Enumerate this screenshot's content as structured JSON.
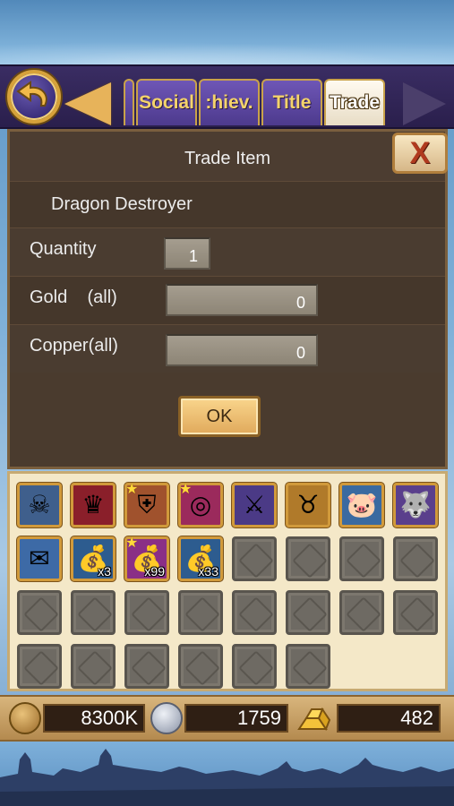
{
  "tabs": [
    {
      "label": "Social",
      "active": false
    },
    {
      "label": ":hiev.",
      "active": false
    },
    {
      "label": "Title",
      "active": false
    },
    {
      "label": "Trade",
      "active": true
    }
  ],
  "dialog": {
    "title": "Trade Item",
    "close_label": "X",
    "item_name": "Dragon Destroyer",
    "quantity_label": "Quantity",
    "quantity_value": "1",
    "gold_label": "Gold    (all)",
    "gold_value": "0",
    "copper_label": "Copper(all)",
    "copper_value": "0",
    "ok_label": "OK"
  },
  "inventory": {
    "items": [
      {
        "icon": "skull-helmet-icon",
        "glyph": "☠",
        "bg": "#3f5f8c",
        "count": "",
        "star": false
      },
      {
        "icon": "crown-icon",
        "glyph": "♛",
        "bg": "#8a1f2a",
        "count": "",
        "star": false
      },
      {
        "icon": "armor-icon",
        "glyph": "⛨",
        "bg": "#a0522d",
        "count": "",
        "star": true
      },
      {
        "icon": "ring-icon",
        "glyph": "◎",
        "bg": "#9b2a5c",
        "count": "",
        "star": true
      },
      {
        "icon": "crossed-axes-icon",
        "glyph": "⚔",
        "bg": "#4b3a86",
        "count": "",
        "star": false
      },
      {
        "icon": "golden-beast-icon",
        "glyph": "♉",
        "bg": "#b07a2a",
        "count": "",
        "star": false
      },
      {
        "icon": "pig-icon",
        "glyph": "🐷",
        "bg": "#3a6aa0",
        "count": "",
        "star": false
      },
      {
        "icon": "wolf-icon",
        "glyph": "🐺",
        "bg": "#5a3f8c",
        "count": "",
        "star": false
      },
      {
        "icon": "scroll-icon",
        "glyph": "✉",
        "bg": "#3d6aa6",
        "count": "",
        "star": false
      },
      {
        "icon": "money-bag-icon",
        "glyph": "💰",
        "bg": "#2d5c8f",
        "count": "x3",
        "star": false
      },
      {
        "icon": "money-bag-icon",
        "glyph": "💰",
        "bg": "#8a2f86",
        "count": "x99",
        "star": true
      },
      {
        "icon": "money-bag-icon",
        "glyph": "💰",
        "bg": "#2d5c8f",
        "count": "x33",
        "star": false
      }
    ],
    "empty_slots": 18
  },
  "currency": {
    "gold": "8300K",
    "silver": "1759",
    "gems": "482"
  },
  "colors": {
    "panel": "#4a3b2e",
    "tab_purple": "#5e47a3",
    "tab_text": "#f4d36b",
    "inventory_bg": "#f4e8c8"
  }
}
